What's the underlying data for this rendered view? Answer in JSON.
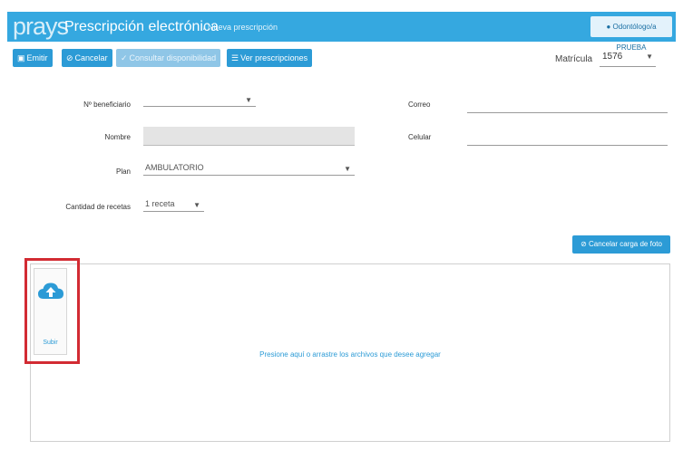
{
  "header": {
    "logo": "prays",
    "title": "Prescripción electrónica",
    "breadcrumb": "/ Nueva prescripción",
    "user_label": "Odontólogo/a PRUEBA"
  },
  "toolbar": {
    "buttons": [
      {
        "label": "Emitir",
        "icon": "floppy-icon",
        "enabled": true
      },
      {
        "label": "Cancelar",
        "icon": "cancel-icon",
        "enabled": true
      },
      {
        "label": "Consultar disponibilidad",
        "icon": "check-icon",
        "enabled": false
      },
      {
        "label": "Ver prescripciones",
        "icon": "list-icon",
        "enabled": true
      }
    ],
    "matricula_label": "Matrícula",
    "matricula_value": "1576"
  },
  "form": {
    "beneficiario_label": "Nº beneficiario",
    "beneficiario_value": "",
    "nombre_label": "Nombre",
    "nombre_value": "",
    "plan_label": "Plan",
    "plan_value": "AMBULATORIO",
    "recetas_label": "Cantidad de recetas",
    "recetas_value": "1 receta",
    "correo_label": "Correo",
    "celular_label": "Celular"
  },
  "cancel_upload_label": "Cancelar carga de foto",
  "dropzone": {
    "text": "Presione aquí o arrastre los archivos que desee agregar",
    "upload_label": "Subir"
  },
  "colors": {
    "brand": "#35a8e0",
    "button": "#2c9bd6",
    "highlight": "#d22b33"
  }
}
